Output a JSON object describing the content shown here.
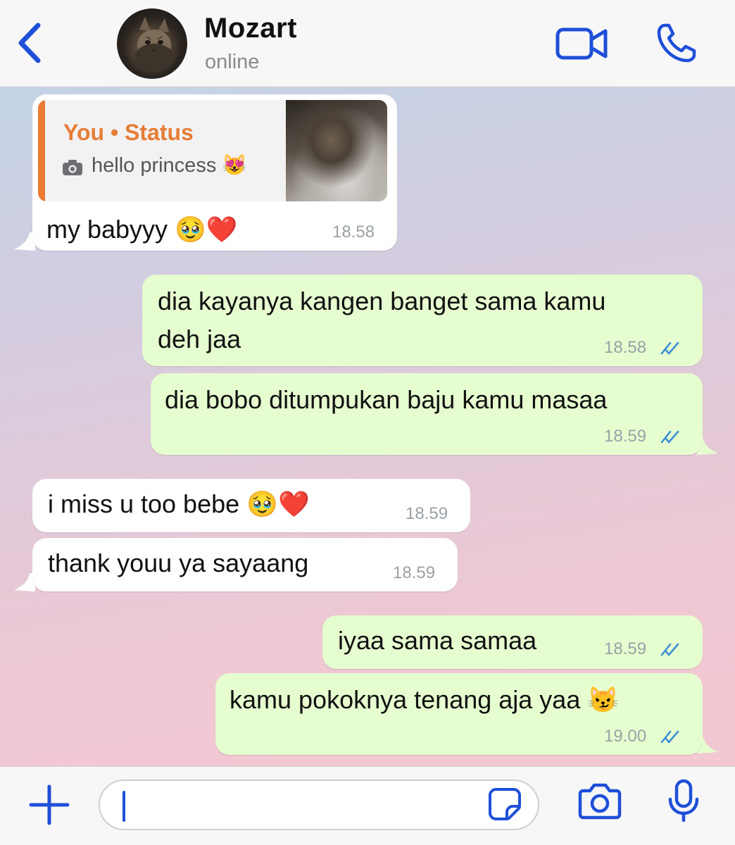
{
  "header": {
    "contact_name": "Mozart",
    "contact_status": "online",
    "icons": [
      "chevron-left-icon",
      "video-camera-icon",
      "phone-icon"
    ]
  },
  "colors": {
    "accent": "#1e4fd8",
    "outgoing_bubble": "#e6fdd0",
    "incoming_bubble": "#ffffff",
    "quote_accent": "#e67d36",
    "read_ticks": "#3b8fd6"
  },
  "messages": [
    {
      "direction": "incoming",
      "quote": {
        "title": "You • Status",
        "caption": "hello princess 😻"
      },
      "text": "my babyyy 🥹❤️",
      "time": "18.58"
    },
    {
      "direction": "outgoing",
      "text_lines": [
        "dia kayanya kangen banget sama kamu",
        "deh jaa"
      ],
      "time": "18.58",
      "status": "read"
    },
    {
      "direction": "outgoing",
      "text": "dia bobo ditumpukan baju kamu masaa",
      "time": "18.59",
      "status": "read"
    },
    {
      "direction": "incoming",
      "text": "i miss u too bebe 🥹❤️",
      "time": "18.59"
    },
    {
      "direction": "incoming",
      "text": "thank youu ya sayaang",
      "time": "18.59"
    },
    {
      "direction": "outgoing",
      "text": "iyaa sama samaa",
      "time": "18.59",
      "status": "read"
    },
    {
      "direction": "outgoing",
      "text": "kamu pokoknya tenang aja yaa 😼",
      "time": "19.00",
      "status": "read"
    }
  ],
  "input_bar": {
    "input_value": "",
    "icons": [
      "plus-icon",
      "sticker-icon",
      "camera-icon",
      "microphone-icon"
    ]
  }
}
